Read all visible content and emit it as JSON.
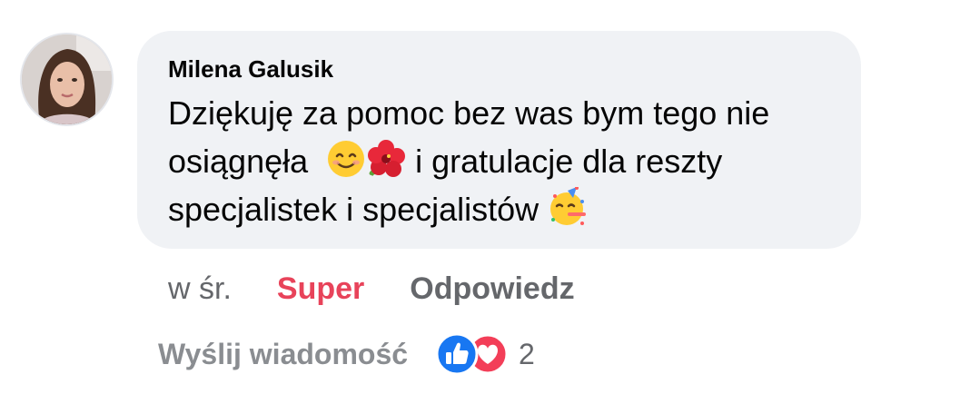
{
  "comment": {
    "author": "Milena Galusik",
    "line1": "Dziękuję za pomoc bez was bym tego nie",
    "line2_text_a": "osiągnęła",
    "line2_text_b": " i gratulacje dla reszty",
    "line3_text": "specjalistek i specjalistów",
    "emojis": [
      "smiling-face-emoji",
      "hibiscus-emoji",
      "partying-face-emoji"
    ]
  },
  "actions": {
    "time": "w śr.",
    "reaction_label": "Super",
    "reply_label": "Odpowiedz"
  },
  "footer": {
    "send_message": "Wyślij wiadomość",
    "reaction_icons": [
      "like-icon",
      "love-icon"
    ],
    "reaction_count": "2"
  },
  "colors": {
    "bubble_bg": "#f0f2f5",
    "reaction_active": "#e8435a",
    "muted": "#65676b",
    "like_blue": "#1877f2",
    "love_red": "#f33e58"
  }
}
